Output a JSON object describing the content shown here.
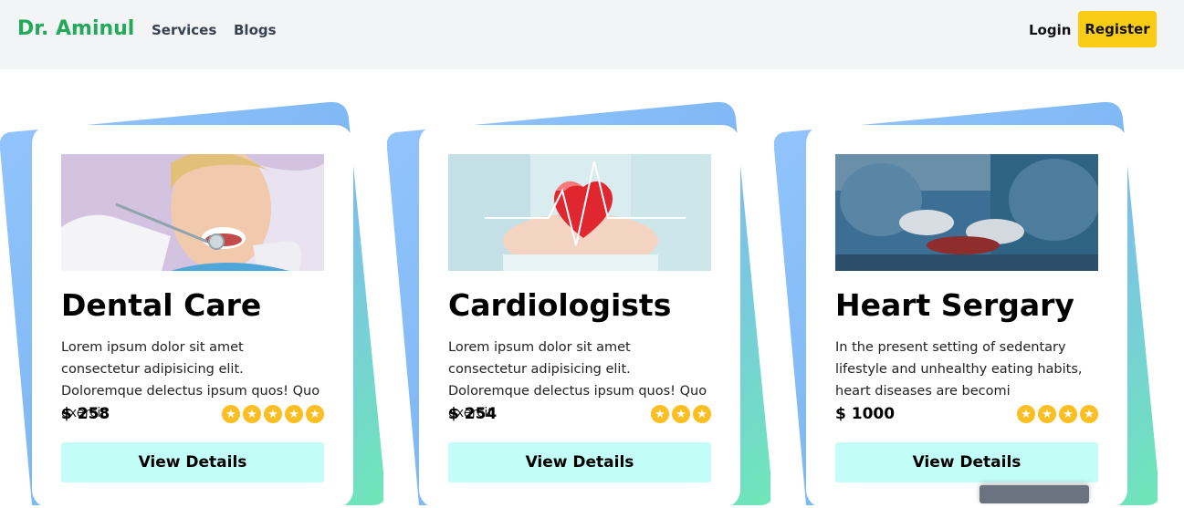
{
  "navbar": {
    "brand": "Dr. Aminul",
    "links": [
      "Services",
      "Blogs"
    ],
    "login_label": "Login",
    "register_label": "Register"
  },
  "colors": {
    "brand": "#22a95a",
    "register_bg": "#facc15",
    "button_bg": "#c3fdf8",
    "star": "#fbbf24",
    "gradient": [
      "#93c5fd",
      "#60a5fa",
      "#6ee7b7"
    ]
  },
  "services": [
    {
      "title": "Dental Care",
      "description": "Lorem ipsum dolor sit amet consectetur adipisicing elit. Doloremque delectus ipsum quos! Quo exercit",
      "price": "$ 258",
      "rating": 5,
      "button_label": "View Details",
      "image": "dentist-photo"
    },
    {
      "title": "Cardiologists",
      "description": "Lorem ipsum dolor sit amet consectetur adipisicing elit. Doloremque delectus ipsum quos! Quo exercit",
      "price": "$ 254",
      "rating": 3,
      "button_label": "View Details",
      "image": "heart-in-hands-photo"
    },
    {
      "title": "Heart Sergary",
      "description": "In the present setting of sedentary lifestyle and unhealthy eating habits, heart diseases are becomi",
      "price": "$ 1000",
      "rating": 4,
      "button_label": "View Details",
      "image": "surgery-photo"
    }
  ]
}
